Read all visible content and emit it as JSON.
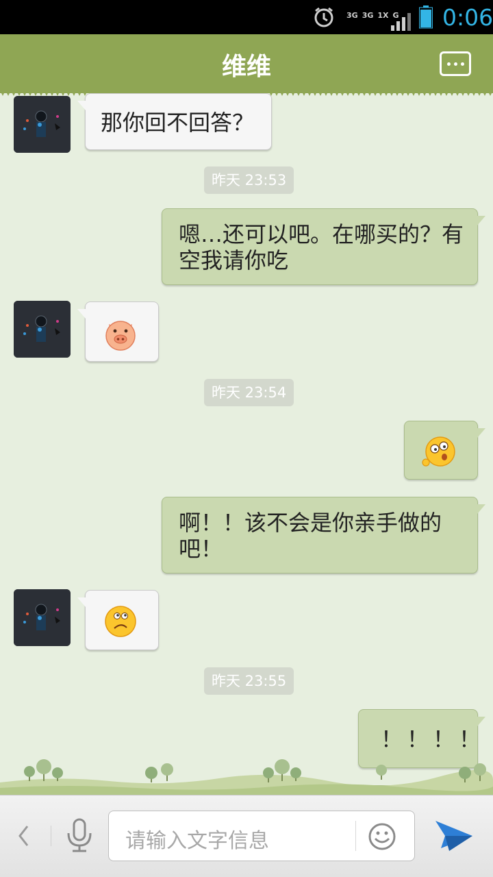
{
  "status_bar": {
    "alarm_icon": "alarm-clock-icon",
    "network_labels": [
      "3G",
      "3G",
      "1X",
      "G"
    ],
    "signal_icon": "signal-bars-icon",
    "battery_icon": "battery-icon",
    "time": "0:06"
  },
  "header": {
    "title": "维维",
    "menu_icon": "chat-more-icon",
    "color": "#8fa654"
  },
  "messages": [
    {
      "side": "in",
      "text": "那你回不回答？"
    },
    {
      "timestamp": "昨天 23:53"
    },
    {
      "side": "out",
      "lines": [
        "嗯…还可以吧。在哪买的？有",
        "空我请你吃"
      ]
    },
    {
      "side": "in",
      "emoji": "pig-face-icon"
    },
    {
      "timestamp": "昨天 23:54"
    },
    {
      "side": "out",
      "emoji": "dizzy-face-icon"
    },
    {
      "side": "out",
      "lines": [
        "啊！！该不会是你亲手做的",
        "吧！"
      ]
    },
    {
      "side": "in",
      "emoji": "puzzled-face-icon"
    },
    {
      "timestamp": "昨天 23:55"
    },
    {
      "side": "out",
      "text": "！！！！"
    }
  ],
  "input": {
    "placeholder": "请输入文字信息",
    "back_icon": "chevron-left-icon",
    "voice_icon": "microphone-icon",
    "emoji_icon": "smiley-icon",
    "send_icon": "paper-plane-icon"
  },
  "colors": {
    "chat_bg": "#e7efdf",
    "bubble_out": "#cad9b0",
    "bubble_in": "#f6f6f6",
    "clock": "#33b5e5",
    "send": "#2e7fd6"
  }
}
